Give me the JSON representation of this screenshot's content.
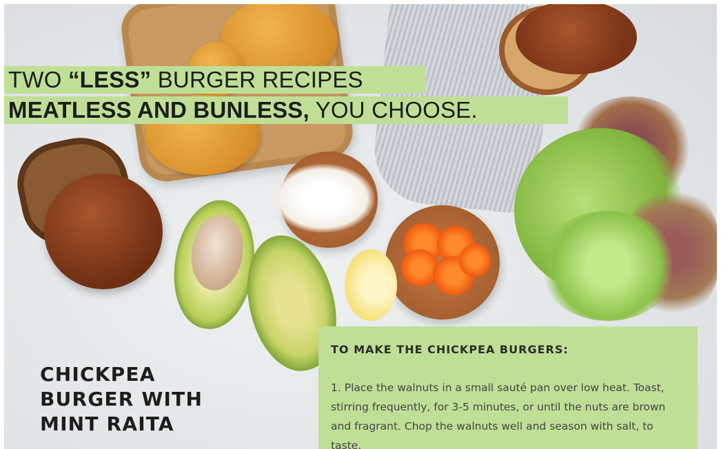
{
  "headline": {
    "line1_part1": "TWO ",
    "line1_bold": "“LESS”",
    "line1_part2": " BURGER RECIPES",
    "line2_bold": "MEATLESS AND BUNLESS,",
    "line2_part2": " YOU CHOOSE."
  },
  "recipe_title": {
    "line1": "CHICKPEA",
    "line2": "BURGER WITH",
    "line3": "MINT RAITA"
  },
  "instructions": {
    "heading": "TO MAKE THE CHICKPEA BURGERS:",
    "step1": "1. Place the walnuts in a small sauté pan over low heat. Toast, stirring frequently, for 3-5 minutes, or until the nuts are brown and fragrant. Chop the walnuts well and season with salt, to taste."
  },
  "colors": {
    "highlight_green": "#bfdf96",
    "text_dark": "#1c1c1c"
  }
}
